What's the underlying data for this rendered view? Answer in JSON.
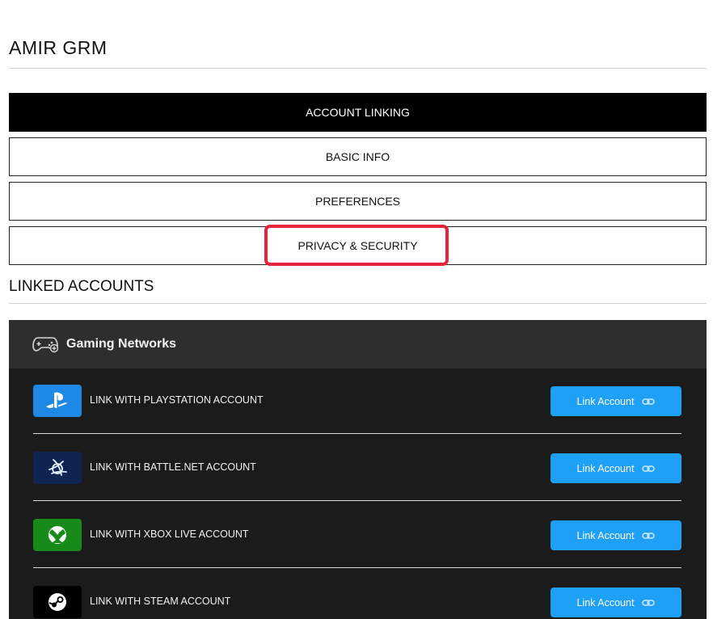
{
  "profile": {
    "username": "AMIR GRM"
  },
  "tabs": [
    {
      "label": "ACCOUNT LINKING",
      "active": true
    },
    {
      "label": "BASIC INFO",
      "active": false
    },
    {
      "label": "PREFERENCES",
      "active": false
    },
    {
      "label": "PRIVACY & SECURITY",
      "active": false,
      "highlighted": true
    }
  ],
  "linked_accounts": {
    "title": "LINKED ACCOUNTS",
    "panel_title": "Gaming Networks",
    "panel_icon": "gamepad-icon",
    "button_label": "Link Account",
    "button_icon": "chain-link-icon",
    "rows": [
      {
        "label": "LINK WITH PLAYSTATION ACCOUNT",
        "icon": "playstation-logo-icon",
        "color": "#1e88e5"
      },
      {
        "label": "LINK WITH BATTLE.NET ACCOUNT",
        "icon": "battlenet-logo-icon",
        "color": "#0f2451"
      },
      {
        "label": "LINK WITH XBOX LIVE ACCOUNT",
        "icon": "xbox-logo-icon",
        "color": "#178a1a"
      },
      {
        "label": "LINK WITH STEAM ACCOUNT",
        "icon": "steam-logo-icon",
        "color": "#000000"
      }
    ]
  },
  "colors": {
    "accent_button": "#1fa0f7",
    "highlight_box": "#e8243c",
    "panel_bg": "#1b1b1b",
    "panel_header_bg": "#2e2e2e"
  }
}
